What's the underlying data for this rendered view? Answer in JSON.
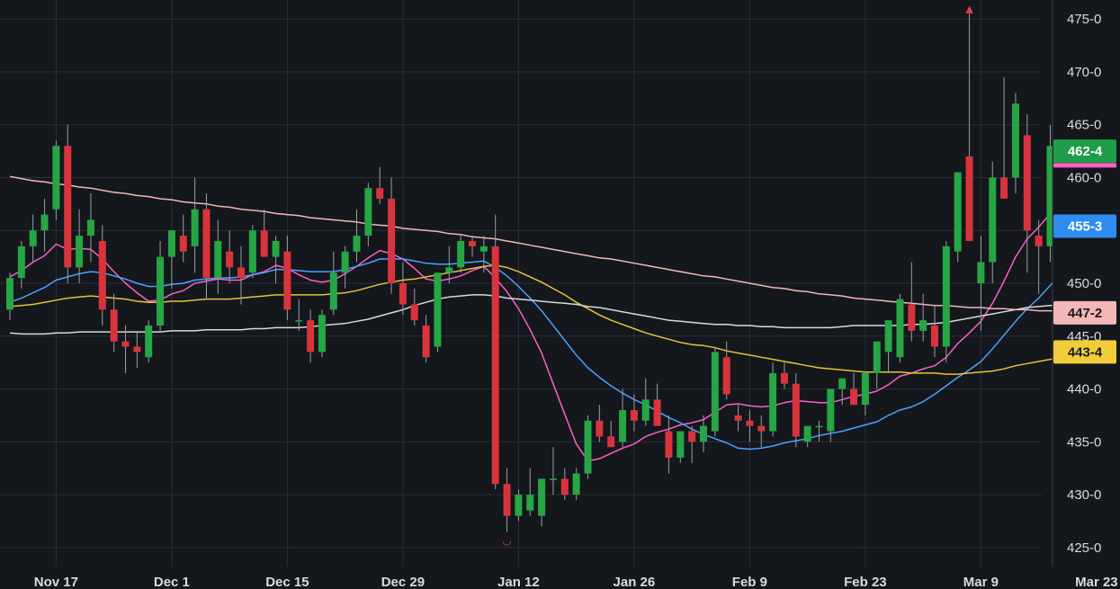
{
  "chart_data": {
    "type": "candlestick",
    "title": "",
    "xlabel": "",
    "ylabel": "",
    "ylim": [
      423.2,
      476.8
    ],
    "grid": true,
    "x_tick_labels": [
      "Nov 17",
      "Dec 1",
      "Dec 15",
      "Dec 29",
      "Jan 12",
      "Jan 26",
      "Feb 9",
      "Feb 23",
      "Mar 9",
      "Mar 23"
    ],
    "y_tick_labels": [
      "475-0",
      "470-0",
      "465-0",
      "460-0",
      "455-0",
      "450-0",
      "445-0",
      "440-0",
      "435-0",
      "430-0",
      "425-0"
    ],
    "candles_ohlc": [
      [
        447.5,
        451.0,
        446.5,
        450.5
      ],
      [
        450.5,
        454.0,
        449.5,
        453.5
      ],
      [
        453.5,
        456.5,
        452.0,
        455.0
      ],
      [
        455.0,
        458.0,
        453.0,
        456.5
      ],
      [
        457.0,
        463.5,
        456.0,
        463.0
      ],
      [
        463.0,
        465.0,
        450.0,
        451.5
      ],
      [
        451.5,
        457.0,
        450.0,
        454.5
      ],
      [
        454.5,
        458.5,
        452.0,
        456.0
      ],
      [
        454.0,
        455.5,
        446.0,
        447.5
      ],
      [
        447.5,
        449.0,
        443.5,
        444.5
      ],
      [
        444.5,
        446.0,
        441.5,
        444.0
      ],
      [
        444.0,
        445.5,
        442.0,
        443.5
      ],
      [
        443.0,
        446.5,
        442.5,
        446.0
      ],
      [
        446.0,
        454.0,
        445.5,
        452.5
      ],
      [
        452.5,
        455.0,
        449.5,
        455.0
      ],
      [
        454.5,
        456.5,
        452.0,
        453.0
      ],
      [
        453.5,
        460.0,
        451.0,
        457.0
      ],
      [
        457.0,
        458.5,
        448.5,
        450.5
      ],
      [
        450.5,
        456.0,
        449.0,
        454.0
      ],
      [
        453.0,
        455.0,
        450.0,
        451.5
      ],
      [
        451.5,
        453.5,
        448.0,
        450.5
      ],
      [
        451.0,
        455.5,
        450.5,
        455.0
      ],
      [
        455.0,
        457.0,
        452.5,
        452.5
      ],
      [
        452.5,
        454.5,
        450.0,
        454.0
      ],
      [
        453.0,
        454.5,
        446.5,
        447.5
      ],
      [
        446.5,
        448.5,
        445.5,
        446.5
      ],
      [
        446.5,
        447.5,
        442.5,
        443.5
      ],
      [
        443.5,
        447.5,
        443.0,
        447.0
      ],
      [
        447.5,
        453.0,
        447.0,
        451.0
      ],
      [
        451.0,
        453.5,
        449.5,
        453.0
      ],
      [
        453.0,
        457.0,
        452.0,
        454.5
      ],
      [
        454.5,
        459.5,
        453.5,
        459.0
      ],
      [
        459.0,
        461.0,
        457.5,
        458.0
      ],
      [
        458.0,
        460.0,
        449.0,
        450.0
      ],
      [
        450.0,
        452.0,
        447.0,
        448.0
      ],
      [
        448.0,
        449.5,
        446.0,
        446.5
      ],
      [
        446.0,
        447.0,
        442.5,
        443.0
      ],
      [
        444.0,
        451.0,
        443.5,
        451.0
      ],
      [
        451.0,
        453.5,
        450.0,
        451.5
      ],
      [
        451.5,
        454.5,
        451.0,
        454.0
      ],
      [
        454.0,
        454.5,
        452.5,
        453.5
      ],
      [
        453.0,
        454.5,
        451.0,
        453.5
      ],
      [
        453.5,
        456.5,
        430.5,
        431.0
      ],
      [
        431.0,
        432.5,
        426.5,
        428.0
      ],
      [
        428.0,
        430.5,
        427.5,
        430.0
      ],
      [
        428.5,
        432.5,
        428.0,
        430.0
      ],
      [
        428.0,
        431.5,
        427.0,
        431.5
      ],
      [
        431.5,
        434.5,
        430.0,
        431.5
      ],
      [
        431.5,
        432.5,
        429.5,
        430.0
      ],
      [
        430.0,
        432.5,
        429.5,
        432.0
      ],
      [
        432.0,
        437.5,
        431.5,
        437.0
      ],
      [
        437.0,
        438.5,
        435.0,
        435.5
      ],
      [
        435.5,
        437.0,
        434.5,
        434.5
      ],
      [
        435.0,
        440.0,
        434.5,
        438.0
      ],
      [
        438.0,
        439.5,
        436.0,
        437.0
      ],
      [
        437.0,
        441.0,
        436.5,
        439.0
      ],
      [
        439.0,
        440.5,
        436.5,
        436.5
      ],
      [
        436.0,
        437.5,
        432.0,
        433.5
      ],
      [
        433.5,
        436.0,
        433.0,
        436.0
      ],
      [
        436.0,
        436.5,
        433.0,
        435.0
      ],
      [
        435.0,
        437.5,
        434.0,
        436.5
      ],
      [
        436.0,
        444.0,
        435.5,
        443.5
      ],
      [
        443.0,
        444.5,
        439.0,
        439.5
      ],
      [
        437.5,
        438.5,
        436.0,
        437.0
      ],
      [
        437.0,
        438.0,
        435.0,
        436.5
      ],
      [
        436.5,
        437.5,
        434.5,
        436.0
      ],
      [
        436.0,
        442.5,
        435.5,
        441.5
      ],
      [
        441.5,
        442.5,
        440.0,
        440.5
      ],
      [
        440.5,
        441.5,
        434.5,
        435.5
      ],
      [
        435.0,
        436.5,
        434.5,
        436.5
      ],
      [
        436.5,
        437.0,
        435.0,
        436.5
      ],
      [
        436.0,
        440.0,
        435.0,
        440.0
      ],
      [
        440.0,
        441.0,
        438.5,
        441.0
      ],
      [
        440.0,
        441.5,
        439.0,
        438.5
      ],
      [
        438.5,
        441.0,
        437.5,
        441.5
      ],
      [
        441.5,
        442.5,
        440.0,
        444.5
      ],
      [
        443.5,
        445.5,
        441.5,
        446.5
      ],
      [
        443.0,
        449.0,
        442.5,
        448.5
      ],
      [
        448.0,
        452.0,
        444.5,
        445.5
      ],
      [
        445.5,
        449.0,
        444.5,
        446.5
      ],
      [
        446.0,
        448.0,
        443.0,
        444.0
      ],
      [
        444.0,
        454.0,
        442.5,
        453.5
      ],
      [
        453.0,
        460.5,
        452.0,
        460.5
      ],
      [
        462.0,
        475.5,
        454.5,
        454.0
      ],
      [
        450.0,
        454.5,
        445.5,
        452.0
      ],
      [
        452.0,
        461.5,
        450.0,
        460.0
      ],
      [
        460.0,
        469.5,
        459.0,
        458.0
      ],
      [
        460.0,
        468.0,
        458.5,
        467.0
      ],
      [
        464.0,
        466.0,
        451.0,
        455.0
      ],
      [
        454.5,
        456.0,
        449.0,
        453.5
      ],
      [
        453.5,
        465.0,
        452.0,
        463.0
      ],
      [
        463.0,
        470.0,
        461.0,
        469.5
      ],
      [
        468.5,
        468.5,
        460.0,
        465.5
      ],
      [
        465.0,
        473.5,
        456.0,
        460.0
      ],
      [
        460.0,
        465.0,
        459.0,
        462.5
      ]
    ],
    "series": [
      {
        "color": "#ff5fc8",
        "values": [
          450.6,
          451.2,
          452.0,
          452.6,
          453.7,
          453.2,
          453.3,
          453.2,
          452.3,
          451.1,
          450.0,
          449.1,
          448.3,
          448.4,
          449.0,
          449.3,
          450.0,
          450.2,
          450.4,
          450.3,
          450.3,
          450.8,
          451.1,
          451.7,
          451.4,
          450.8,
          450.3,
          450.1,
          450.3,
          450.9,
          451.6,
          452.4,
          453.1,
          452.8,
          452.3,
          451.4,
          450.4,
          450.2,
          450.4,
          450.7,
          451.2,
          451.6,
          450.5,
          449.2,
          447.6,
          445.6,
          443.4,
          440.5,
          437.6,
          434.8,
          433.2,
          433.4,
          433.9,
          434.4,
          434.8,
          435.5,
          435.9,
          436.2,
          436.6,
          436.8,
          437.1,
          437.8,
          438.5,
          438.6,
          438.4,
          438.3,
          438.4,
          438.7,
          438.9,
          438.8,
          438.7,
          438.7,
          439.0,
          439.3,
          439.5,
          439.8,
          440.4,
          441.2,
          441.5,
          441.9,
          442.2,
          443.0,
          444.3,
          445.3,
          446.4,
          448.1,
          450.2,
          452.5,
          454.2,
          455.3,
          456.6,
          458.5,
          459.8,
          460.3,
          461.2
        ]
      },
      {
        "color": "#49a3ff",
        "values": [
          448.2,
          448.6,
          449.1,
          449.6,
          450.3,
          450.6,
          450.9,
          451.1,
          451.0,
          450.7,
          450.4,
          450.0,
          449.7,
          449.7,
          449.9,
          450.0,
          450.3,
          450.4,
          450.5,
          450.5,
          450.6,
          450.8,
          451.0,
          451.3,
          451.3,
          451.2,
          451.1,
          451.1,
          451.1,
          451.3,
          451.6,
          451.9,
          452.3,
          452.3,
          452.3,
          452.1,
          451.9,
          451.8,
          451.8,
          451.9,
          452.0,
          452.1,
          451.5,
          450.7,
          449.7,
          448.6,
          447.4,
          446.0,
          444.6,
          443.2,
          442.0,
          441.1,
          440.3,
          439.6,
          439.0,
          438.5,
          437.9,
          437.3,
          436.8,
          436.2,
          435.7,
          435.3,
          434.9,
          434.4,
          434.3,
          434.4,
          434.6,
          434.9,
          435.1,
          435.3,
          435.6,
          435.8,
          436.0,
          436.3,
          436.6,
          436.9,
          437.5,
          438.0,
          438.3,
          438.8,
          439.5,
          440.3,
          441.1,
          441.8,
          442.6,
          443.8,
          445.1,
          446.4,
          447.6,
          448.6,
          449.8,
          451.2,
          452.4,
          453.2,
          454.5
        ]
      },
      {
        "color": "#e8c33a",
        "values": [
          447.8,
          447.9,
          448.0,
          448.2,
          448.4,
          448.6,
          448.7,
          448.8,
          448.7,
          448.6,
          448.5,
          448.3,
          448.2,
          448.2,
          448.3,
          448.3,
          448.4,
          448.5,
          448.5,
          448.5,
          448.6,
          448.7,
          448.8,
          448.9,
          448.9,
          448.9,
          448.9,
          448.9,
          449.0,
          449.1,
          449.3,
          449.6,
          449.9,
          450.1,
          450.3,
          450.4,
          450.6,
          450.8,
          451.0,
          451.2,
          451.4,
          451.6,
          451.7,
          451.5,
          451.1,
          450.6,
          450.1,
          449.5,
          448.9,
          448.2,
          447.6,
          447.0,
          446.5,
          446.1,
          445.7,
          445.3,
          445.0,
          444.7,
          444.4,
          444.2,
          444.1,
          443.9,
          443.6,
          443.4,
          443.2,
          443.0,
          442.8,
          442.6,
          442.4,
          442.2,
          442.0,
          441.9,
          441.8,
          441.7,
          441.6,
          441.6,
          441.6,
          441.6,
          441.5,
          441.5,
          441.5,
          441.4,
          441.4,
          441.5,
          441.6,
          441.7,
          441.9,
          442.2,
          442.4,
          442.6,
          442.8,
          443.0,
          443.1,
          443.2,
          443.4
        ]
      },
      {
        "color": "#d8dadc",
        "values": [
          445.3,
          445.2,
          445.2,
          445.2,
          445.3,
          445.3,
          445.4,
          445.4,
          445.4,
          445.4,
          445.4,
          445.4,
          445.4,
          445.4,
          445.5,
          445.5,
          445.5,
          445.6,
          445.6,
          445.6,
          445.6,
          445.7,
          445.7,
          445.8,
          445.8,
          445.8,
          445.9,
          446.0,
          446.1,
          446.2,
          446.4,
          446.6,
          446.9,
          447.2,
          447.5,
          447.9,
          448.2,
          448.5,
          448.7,
          448.8,
          448.9,
          448.9,
          448.8,
          448.6,
          448.5,
          448.4,
          448.3,
          448.2,
          448.1,
          448.0,
          447.8,
          447.7,
          447.5,
          447.3,
          447.1,
          446.9,
          446.7,
          446.5,
          446.4,
          446.3,
          446.2,
          446.1,
          446.1,
          446.0,
          446.0,
          445.9,
          445.9,
          445.8,
          445.8,
          445.8,
          445.8,
          445.8,
          445.9,
          446.0,
          446.0,
          446.0,
          446.0,
          446.0,
          446.1,
          446.1,
          446.2,
          446.3,
          446.5,
          446.7,
          446.9,
          447.1,
          447.3,
          447.5,
          447.7,
          447.8,
          447.9,
          448.0,
          448.1,
          448.2,
          448.3
        ]
      },
      {
        "color": "#f4b7b7",
        "values": [
          460.1,
          459.9,
          459.7,
          459.6,
          459.4,
          459.3,
          459.1,
          459.0,
          458.8,
          458.6,
          458.5,
          458.3,
          458.2,
          458.0,
          457.9,
          457.7,
          457.6,
          457.5,
          457.3,
          457.2,
          457.0,
          456.9,
          456.8,
          456.6,
          456.5,
          456.4,
          456.2,
          456.1,
          456.0,
          455.9,
          455.8,
          455.6,
          455.5,
          455.4,
          455.2,
          455.1,
          455.0,
          454.9,
          454.7,
          454.6,
          454.4,
          454.3,
          454.2,
          454.0,
          453.8,
          453.6,
          453.4,
          453.2,
          453.0,
          452.8,
          452.6,
          452.4,
          452.3,
          452.1,
          451.9,
          451.7,
          451.5,
          451.3,
          451.1,
          450.9,
          450.7,
          450.6,
          450.4,
          450.2,
          450.0,
          449.8,
          449.6,
          449.5,
          449.3,
          449.2,
          449.0,
          448.9,
          448.8,
          448.6,
          448.5,
          448.4,
          448.3,
          448.2,
          448.1,
          448.0,
          447.9,
          447.9,
          447.8,
          447.7,
          447.7,
          447.6,
          447.6,
          447.5,
          447.5,
          447.4,
          447.4,
          447.3,
          447.3,
          447.3,
          447.2
        ]
      }
    ],
    "markers": [
      {
        "text": "▲",
        "color": "#e0404a"
      },
      {
        "text": "◡",
        "color": "#e0404a"
      }
    ],
    "price_badges": [
      {
        "text": "462-4",
        "y": 462.5,
        "bg": "#1f9d48",
        "fg": "#ffffff"
      },
      {
        "text": "455-3",
        "y": 455.4,
        "bg": "#2f8cf0",
        "fg": "#ffffff"
      },
      {
        "text": "447-2",
        "y": 447.2,
        "bg": "#f4b7b7",
        "fg": "#1a1a1a"
      },
      {
        "text": "443-4",
        "y": 443.5,
        "bg": "#f1cd3c",
        "fg": "#1a1a1a"
      }
    ],
    "colors": {
      "up": "#26a644",
      "down": "#d9343d",
      "grid": "#2b2f36",
      "wick": "#9aa0a8",
      "background": "#14171c"
    }
  }
}
